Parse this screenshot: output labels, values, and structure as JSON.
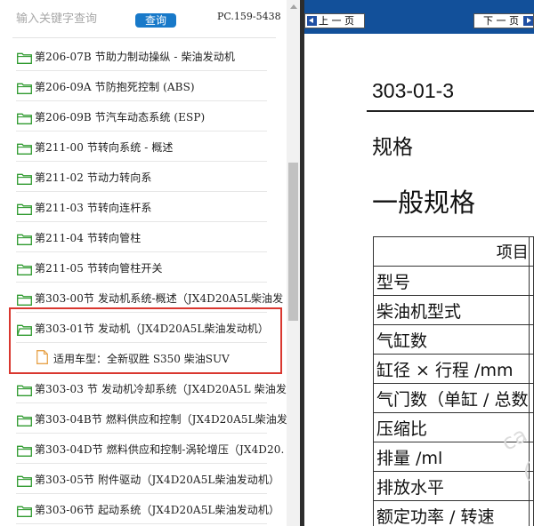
{
  "search": {
    "placeholder": "输入关键字查询",
    "button_label": "查询",
    "pc_code": "PC.159-5438"
  },
  "tree": {
    "items": [
      {
        "label": "第206-07B 节助力制动操纵 - 柴油发动机",
        "icon": "folder-icon"
      },
      {
        "label": "第206-09A 节防抱死控制 (ABS)",
        "icon": "folder-icon"
      },
      {
        "label": "第206-09B 节汽车动态系统 (ESP)",
        "icon": "folder-icon"
      },
      {
        "label": "第211-00 节转向系统 - 概述",
        "icon": "folder-icon"
      },
      {
        "label": "第211-02 节动力转向系",
        "icon": "folder-icon"
      },
      {
        "label": "第211-03 节转向连杆系",
        "icon": "folder-icon"
      },
      {
        "label": "第211-04 节转向管柱",
        "icon": "folder-icon"
      },
      {
        "label": "第211-05 节转向管柱开关",
        "icon": "folder-icon"
      },
      {
        "label": "第303-00节 发动机系统-概述（JX4D20A5L柴油发",
        "icon": "folder-icon"
      },
      {
        "label": "第303-01节 发动机（JX4D20A5L柴油发动机）",
        "icon": "folder-open-icon",
        "expanded": true,
        "children": [
          {
            "label": "适用车型：全新驭胜 S350 柴油SUV",
            "icon": "file-icon"
          }
        ]
      },
      {
        "label": "第303-03 节 发动机冷却系统（JX4D20A5L 柴油发",
        "icon": "folder-icon"
      },
      {
        "label": "第303-04B节 燃料供应和控制（JX4D20A5L柴油发",
        "icon": "folder-icon"
      },
      {
        "label": "第303-04D节 燃料供应和控制-涡轮增压（JX4D20.",
        "icon": "folder-icon"
      },
      {
        "label": "第303-05节 附件驱动（JX4D20A5L柴油发动机）",
        "icon": "folder-icon"
      },
      {
        "label": "第303-06节 起动系统（JX4D20A5L柴油发动机）",
        "icon": "folder-icon"
      }
    ]
  },
  "viewer": {
    "prev_label": "上 一 页",
    "next_label": "下 一 页",
    "doc_code": "303-01-3",
    "section_title": "规格",
    "heading": "一般规格",
    "table": {
      "header": "项目",
      "rows": [
        "型号",
        "柴油机型式",
        "气缸数",
        "缸径 × 行程 /mm",
        "气门数（单缸 / 总数",
        "压缩比",
        "排量 /ml",
        "排放水平",
        "额定功率 / 转速"
      ]
    },
    "watermark": "ca"
  },
  "colors": {
    "accent_blue": "#1879c9",
    "viewer_bar": "#12509a",
    "folder_green": "#2f9a2f",
    "highlight_red": "#d9372f"
  }
}
